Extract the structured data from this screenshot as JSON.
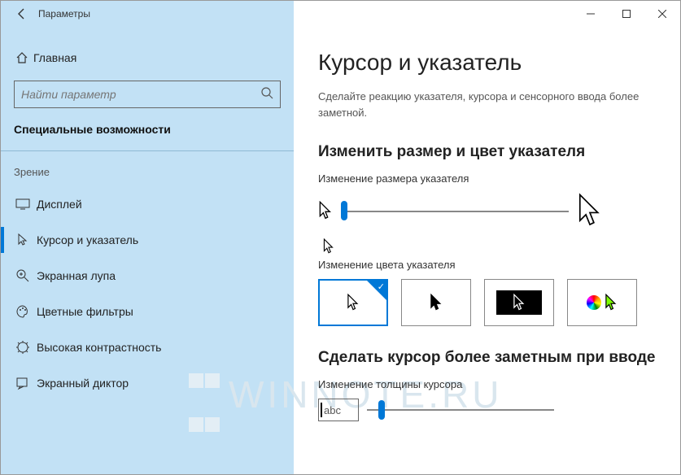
{
  "window": {
    "title": "Параметры"
  },
  "sidebar": {
    "home": "Главная",
    "search_placeholder": "Найти параметр",
    "section": "Специальные возможности",
    "group": "Зрение",
    "items": [
      {
        "label": "Дисплей"
      },
      {
        "label": "Курсор и указатель"
      },
      {
        "label": "Экранная лупа"
      },
      {
        "label": "Цветные фильтры"
      },
      {
        "label": "Высокая контрастность"
      },
      {
        "label": "Экранный диктор"
      }
    ]
  },
  "content": {
    "title": "Курсор и указатель",
    "description": "Сделайте реакцию указателя, курсора и сенсорного ввода более заметной.",
    "size_heading": "Изменить размер и цвет указателя",
    "size_label": "Изменение размера указателя",
    "color_label": "Изменение цвета указателя",
    "thickness_heading": "Сделать курсор более заметным при вводе",
    "thickness_label": "Изменение толщины курсора",
    "thickness_preview": "abc"
  },
  "watermark": "WINNOTE.RU"
}
